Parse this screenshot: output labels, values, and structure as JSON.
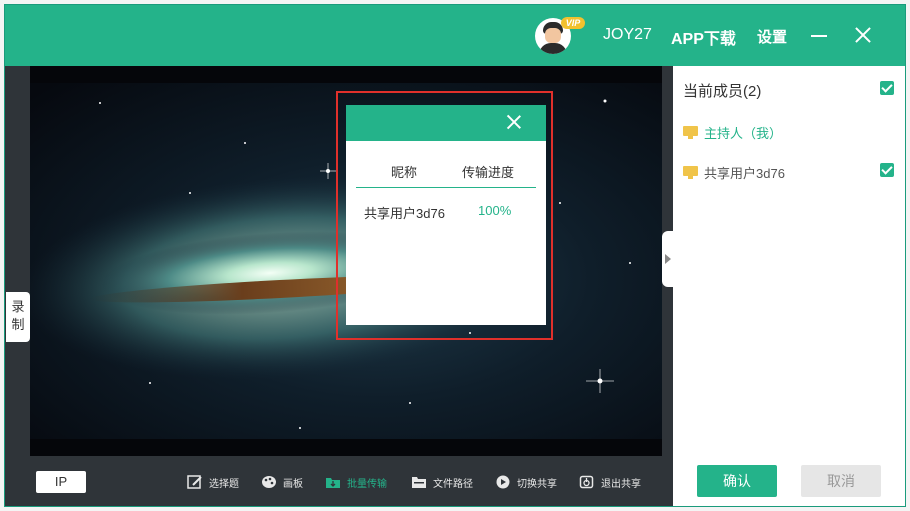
{
  "header": {
    "vip_badge": "VIP",
    "username": "JOY27",
    "app_download": "APP下载",
    "settings": "设置"
  },
  "record_tab": {
    "label_line1": "录",
    "label_line2": "制"
  },
  "dialog": {
    "columns": [
      "昵称",
      "传输进度"
    ],
    "rows": [
      {
        "nickname": "共享用户3d76",
        "progress": "100%"
      }
    ]
  },
  "toolbar": {
    "ip": "IP",
    "items": [
      {
        "label": "选择题",
        "icon": "edit-icon"
      },
      {
        "label": "画板",
        "icon": "palette-icon"
      },
      {
        "label": "批量传输",
        "icon": "batch-transfer-icon",
        "active": true
      },
      {
        "label": "文件路径",
        "icon": "folder-icon"
      },
      {
        "label": "切换共享",
        "icon": "switch-share-icon"
      },
      {
        "label": "退出共享",
        "icon": "exit-share-icon"
      }
    ]
  },
  "panel": {
    "title": "当前成员(2)",
    "members": [
      {
        "name": "主持人（我）",
        "host": true
      },
      {
        "name": "共享用户3d76",
        "host": false
      }
    ],
    "confirm": "确认",
    "cancel": "取消"
  },
  "colors": {
    "accent": "#24b38a",
    "highlight": "#e0302b",
    "dark": "#2f3439"
  }
}
